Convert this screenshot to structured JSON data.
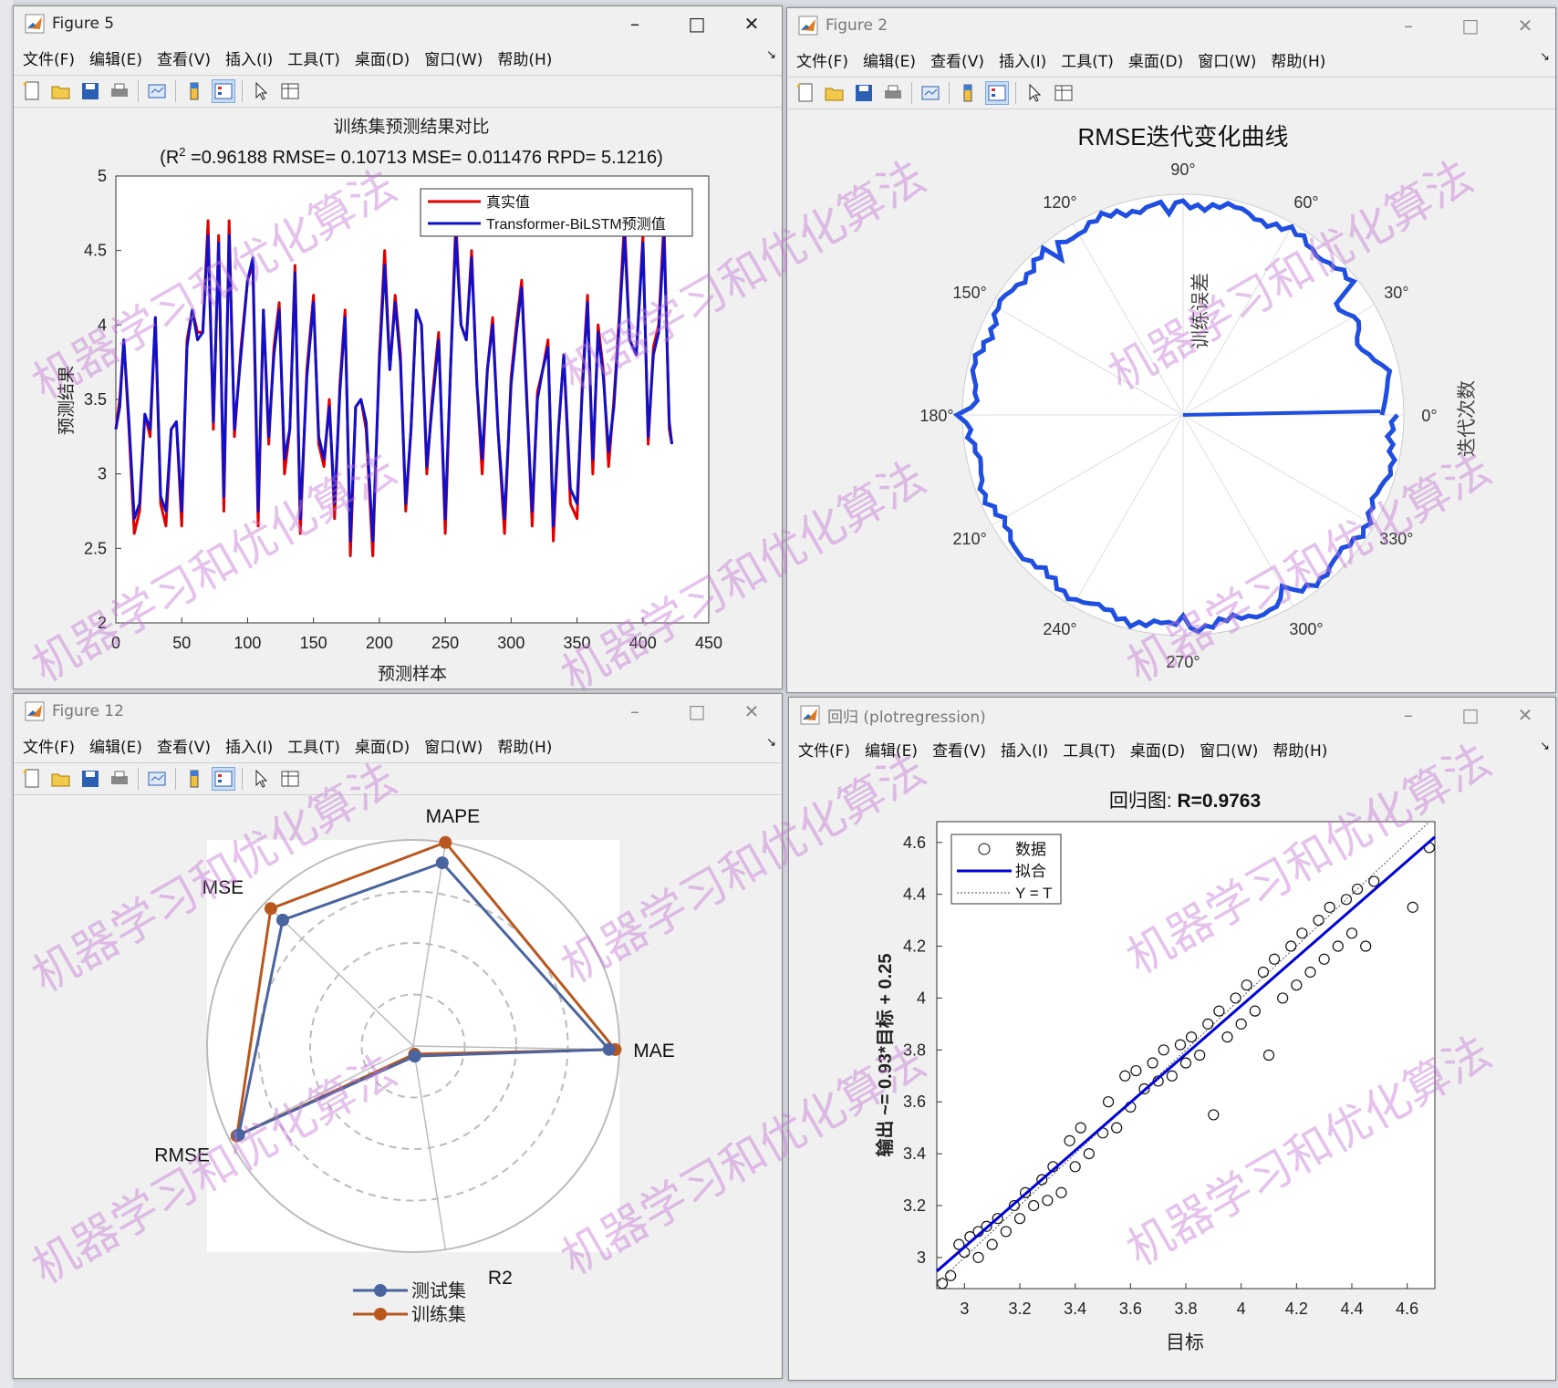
{
  "menu": [
    "文件(F)",
    "编辑(E)",
    "查看(V)",
    "插入(I)",
    "工具(T)",
    "桌面(D)",
    "窗口(W)",
    "帮助(H)"
  ],
  "colors": {
    "true": "#e00000",
    "pred": "#1010c8",
    "polar": "#1f4ee0",
    "test": "#4a64a0",
    "train": "#b8571e",
    "regfit": "#0000d8",
    "window_bg": "#f0f0f0"
  },
  "watermark": "机器学习和优化算法",
  "figure5": {
    "title": "Figure 5",
    "plot_title": "训练集预测结果对比",
    "subtitle_pre": "(R",
    "subtitle_sup": "2",
    "subtitle_post": " =0.96188 RMSE= 0.10713 MSE= 0.011476 RPD= 5.1216)",
    "chart_data": {
      "type": "line",
      "xlabel": "预测样本",
      "ylabel": "预测结果",
      "xlim": [
        0,
        450
      ],
      "ylim": [
        2,
        5
      ],
      "xticks": [
        "0",
        "50",
        "100",
        "150",
        "200",
        "250",
        "300",
        "350",
        "400",
        "450"
      ],
      "yticks": [
        "2",
        "2.5",
        "3",
        "3.5",
        "4",
        "4.5",
        "5"
      ],
      "legend_position": "top-right",
      "series": [
        {
          "name": "真实值",
          "x": [
            0,
            3,
            6,
            10,
            14,
            18,
            22,
            26,
            30,
            34,
            38,
            42,
            46,
            50,
            54,
            58,
            62,
            66,
            70,
            74,
            78,
            82,
            86,
            90,
            95,
            100,
            104,
            108,
            112,
            116,
            120,
            124,
            128,
            132,
            136,
            140,
            145,
            150,
            154,
            158,
            162,
            166,
            170,
            174,
            178,
            182,
            186,
            190,
            195,
            200,
            204,
            208,
            212,
            216,
            220,
            224,
            228,
            232,
            236,
            240,
            245,
            250,
            254,
            258,
            262,
            266,
            270,
            274,
            278,
            282,
            286,
            290,
            295,
            300,
            304,
            308,
            312,
            316,
            320,
            324,
            328,
            332,
            336,
            340,
            345,
            350,
            354,
            358,
            362,
            366,
            370,
            374,
            378,
            382,
            386,
            390,
            395,
            400,
            404,
            408,
            412,
            416,
            420,
            422
          ],
          "y": [
            3.3,
            3.5,
            3.9,
            3.3,
            2.6,
            2.75,
            3.4,
            3.25,
            4.05,
            2.8,
            2.65,
            3.3,
            3.35,
            2.65,
            3.9,
            4.1,
            3.95,
            3.95,
            4.7,
            3.3,
            4.6,
            2.75,
            4.7,
            3.25,
            3.85,
            4.3,
            4.4,
            2.65,
            4.1,
            3.2,
            3.85,
            4.15,
            3.0,
            3.3,
            4.4,
            2.6,
            3.7,
            4.2,
            3.2,
            3.05,
            3.5,
            2.7,
            3.6,
            4.1,
            2.45,
            3.45,
            3.5,
            3.3,
            2.45,
            3.8,
            4.5,
            3.7,
            4.2,
            3.8,
            2.75,
            3.3,
            4.1,
            4.0,
            3.0,
            3.5,
            3.95,
            2.6,
            3.7,
            4.7,
            4.0,
            3.9,
            4.5,
            3.6,
            3.0,
            3.7,
            4.05,
            3.3,
            2.6,
            3.65,
            4.0,
            4.3,
            3.5,
            2.65,
            3.55,
            3.7,
            3.9,
            2.55,
            3.3,
            3.8,
            2.8,
            2.7,
            3.6,
            4.2,
            3.0,
            4.0,
            3.7,
            3.05,
            3.5,
            4.05,
            4.7,
            3.9,
            3.8,
            4.6,
            3.2,
            3.85,
            4.0,
            4.7,
            3.3,
            3.2
          ]
        },
        {
          "name": "Transformer-BiLSTM预测值",
          "x": [
            0,
            3,
            6,
            10,
            14,
            18,
            22,
            26,
            30,
            34,
            38,
            42,
            46,
            50,
            54,
            58,
            62,
            66,
            70,
            74,
            78,
            82,
            86,
            90,
            95,
            100,
            104,
            108,
            112,
            116,
            120,
            124,
            128,
            132,
            136,
            140,
            145,
            150,
            154,
            158,
            162,
            166,
            170,
            174,
            178,
            182,
            186,
            190,
            195,
            200,
            204,
            208,
            212,
            216,
            220,
            224,
            228,
            232,
            236,
            240,
            245,
            250,
            254,
            258,
            262,
            266,
            270,
            274,
            278,
            282,
            286,
            290,
            295,
            300,
            304,
            308,
            312,
            316,
            320,
            324,
            328,
            332,
            336,
            340,
            345,
            350,
            354,
            358,
            362,
            366,
            370,
            374,
            378,
            382,
            386,
            390,
            395,
            400,
            404,
            408,
            412,
            416,
            420,
            422
          ],
          "y": [
            3.3,
            3.45,
            3.9,
            3.35,
            2.7,
            2.8,
            3.4,
            3.3,
            4.05,
            2.85,
            2.75,
            3.3,
            3.35,
            2.75,
            3.85,
            4.1,
            3.9,
            3.95,
            4.6,
            3.35,
            4.55,
            2.85,
            4.6,
            3.3,
            3.8,
            4.3,
            4.45,
            2.75,
            4.1,
            3.25,
            3.8,
            4.1,
            3.1,
            3.3,
            4.35,
            2.7,
            3.65,
            4.15,
            3.25,
            3.1,
            3.45,
            2.8,
            3.55,
            4.05,
            2.55,
            3.45,
            3.5,
            3.35,
            2.55,
            3.75,
            4.4,
            3.7,
            4.15,
            3.75,
            2.8,
            3.3,
            4.1,
            4.0,
            3.05,
            3.45,
            3.9,
            2.7,
            3.7,
            4.6,
            4.0,
            3.9,
            4.45,
            3.6,
            3.1,
            3.7,
            4.0,
            3.3,
            2.7,
            3.6,
            3.95,
            4.25,
            3.45,
            2.75,
            3.5,
            3.7,
            3.85,
            2.65,
            3.3,
            3.8,
            2.9,
            2.8,
            3.55,
            4.15,
            3.1,
            3.95,
            3.65,
            3.15,
            3.45,
            4.0,
            4.6,
            3.9,
            3.8,
            4.55,
            3.25,
            3.8,
            3.95,
            4.6,
            3.35,
            3.2
          ]
        }
      ]
    }
  },
  "figure2": {
    "title": "Figure 2",
    "chart_data": {
      "type": "line",
      "title": "RMSE迭代变化曲线",
      "angle_label": "训练误差",
      "radius_label": "迭代次数",
      "angle_ticks": [
        "0°",
        "30°",
        "60°",
        "90°",
        "120°",
        "150°",
        "180°",
        "210°",
        "240°",
        "270°",
        "300°",
        "330°"
      ],
      "series": [
        {
          "name": "RMSE"
        }
      ]
    }
  },
  "figure12": {
    "title": "Figure 12",
    "chart_data": {
      "type": "radar",
      "axes": [
        "MAPE",
        "MAE",
        "R2",
        "RMSE",
        "MSE"
      ],
      "legend_position": "bottom",
      "series": [
        {
          "name": "测试集",
          "values": [
            0.9,
            0.95,
            0.05,
            0.95,
            0.88
          ]
        },
        {
          "name": "训练集",
          "values": [
            1.0,
            0.98,
            0.04,
            0.96,
            0.96
          ]
        }
      ]
    }
  },
  "figure_reg": {
    "title": "回归 (plotregression)",
    "title_pre": "回归图: ",
    "title_bold": "R=0.9763",
    "chart_data": {
      "type": "scatter",
      "xlabel": "目标",
      "ylabel": "输出 ~= 0.93*目标 + 0.25",
      "xlim": [
        2.9,
        4.7
      ],
      "ylim": [
        2.88,
        4.68
      ],
      "xticks": [
        "3",
        "3.2",
        "3.4",
        "3.6",
        "3.8",
        "4",
        "4.2",
        "4.4",
        "4.6"
      ],
      "yticks": [
        "3",
        "3.2",
        "3.4",
        "3.6",
        "3.8",
        "4",
        "4.2",
        "4.4",
        "4.6"
      ],
      "legend": [
        "数据",
        "拟合",
        "Y = T"
      ],
      "fit": {
        "slope": 0.93,
        "intercept": 0.25
      },
      "points": [
        [
          2.92,
          2.9
        ],
        [
          2.95,
          2.93
        ],
        [
          2.98,
          3.05
        ],
        [
          3.0,
          3.02
        ],
        [
          3.02,
          3.08
        ],
        [
          3.05,
          3.0
        ],
        [
          3.05,
          3.1
        ],
        [
          3.08,
          3.12
        ],
        [
          3.1,
          3.05
        ],
        [
          3.12,
          3.15
        ],
        [
          3.15,
          3.1
        ],
        [
          3.18,
          3.2
        ],
        [
          3.2,
          3.15
        ],
        [
          3.22,
          3.25
        ],
        [
          3.25,
          3.2
        ],
        [
          3.28,
          3.3
        ],
        [
          3.3,
          3.22
        ],
        [
          3.32,
          3.35
        ],
        [
          3.35,
          3.25
        ],
        [
          3.38,
          3.45
        ],
        [
          3.4,
          3.35
        ],
        [
          3.42,
          3.5
        ],
        [
          3.45,
          3.4
        ],
        [
          3.5,
          3.48
        ],
        [
          3.52,
          3.6
        ],
        [
          3.55,
          3.5
        ],
        [
          3.58,
          3.7
        ],
        [
          3.6,
          3.58
        ],
        [
          3.62,
          3.72
        ],
        [
          3.65,
          3.65
        ],
        [
          3.68,
          3.75
        ],
        [
          3.7,
          3.68
        ],
        [
          3.72,
          3.8
        ],
        [
          3.75,
          3.7
        ],
        [
          3.78,
          3.82
        ],
        [
          3.8,
          3.75
        ],
        [
          3.82,
          3.85
        ],
        [
          3.85,
          3.78
        ],
        [
          3.88,
          3.9
        ],
        [
          3.9,
          3.55
        ],
        [
          3.92,
          3.95
        ],
        [
          3.95,
          3.85
        ],
        [
          3.98,
          4.0
        ],
        [
          4.0,
          3.9
        ],
        [
          4.02,
          4.05
        ],
        [
          4.05,
          3.95
        ],
        [
          4.08,
          4.1
        ],
        [
          4.1,
          3.78
        ],
        [
          4.12,
          4.15
        ],
        [
          4.15,
          4.0
        ],
        [
          4.18,
          4.2
        ],
        [
          4.2,
          4.05
        ],
        [
          4.22,
          4.25
        ],
        [
          4.25,
          4.1
        ],
        [
          4.28,
          4.3
        ],
        [
          4.3,
          4.15
        ],
        [
          4.32,
          4.35
        ],
        [
          4.35,
          4.2
        ],
        [
          4.38,
          4.38
        ],
        [
          4.4,
          4.25
        ],
        [
          4.42,
          4.42
        ],
        [
          4.45,
          4.2
        ],
        [
          4.48,
          4.45
        ],
        [
          4.62,
          4.35
        ],
        [
          4.68,
          4.58
        ]
      ]
    }
  },
  "icons": [
    "matlab-logo-icon",
    "new-file-icon",
    "open-folder-icon",
    "save-icon",
    "print-icon",
    "link-plot-icon",
    "colorbar-icon",
    "legend-icon",
    "pointer-icon",
    "property-inspector-icon",
    "dock-arrow-icon",
    "minimize-icon",
    "maximize-icon",
    "close-icon"
  ]
}
